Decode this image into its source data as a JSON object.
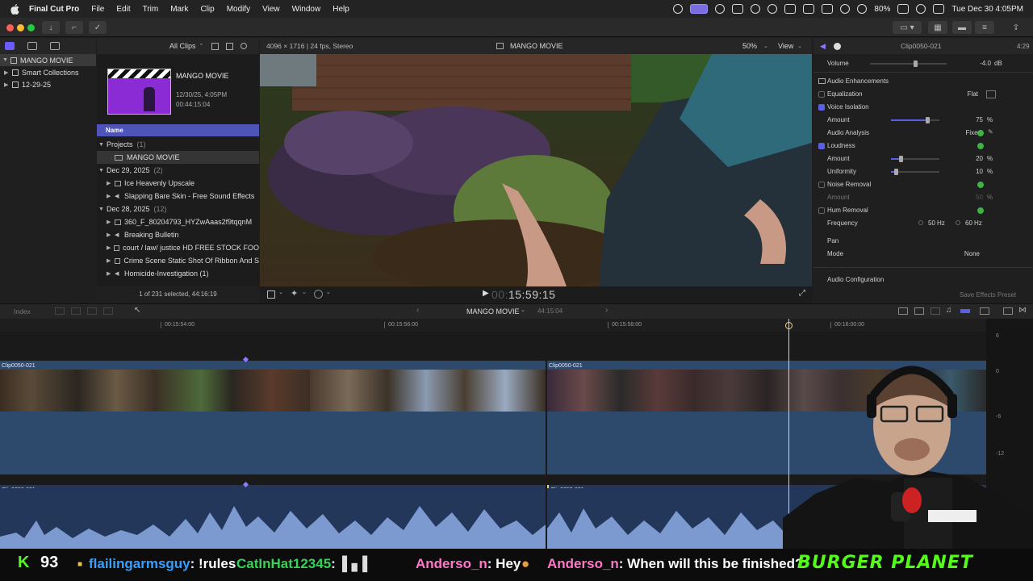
{
  "menubar": {
    "app_name": "Final Cut Pro",
    "items": [
      "File",
      "Edit",
      "Trim",
      "Mark",
      "Clip",
      "Modify",
      "View",
      "Window",
      "Help"
    ],
    "battery": "80%",
    "datetime": "Tue Dec 30  4:05PM"
  },
  "library": {
    "root": "MANGO MOVIE",
    "items": [
      {
        "label": "Smart Collections"
      },
      {
        "label": "12-29-25"
      }
    ]
  },
  "browser": {
    "filter": "All Clips",
    "project_title": "MANGO MOVIE",
    "project_date": "12/30/25, 4:05PM",
    "project_duration": "00:44:15:04",
    "column_name": "Name",
    "groups": [
      {
        "label": "Projects",
        "count": "(1)",
        "rows": [
          "MANGO MOVIE"
        ]
      },
      {
        "label": "Dec 29, 2025",
        "count": "(2)",
        "rows": [
          "Ice Heavenly Upscale",
          "Slapping Bare Skin - Free Sound Effects"
        ]
      },
      {
        "label": "Dec 28, 2025",
        "count": "(12)",
        "rows": [
          "360_F_80204793_HYZwAaas2f9tqqnM",
          "Breaking Bulletin",
          "court / law/ justice HD FREE STOCK FOO",
          "Crime Scene Static Shot Of Ribbon And S",
          "Homicide-Investigation (1)"
        ]
      }
    ],
    "footer": "1 of 231 selected, 44:16:19"
  },
  "viewer": {
    "format": "4096 × 1716 | 24 fps, Stereo",
    "title": "MANGO MOVIE",
    "zoom": "50%",
    "view_label": "View",
    "timecode_dim": "00:",
    "timecode": "15:59:15"
  },
  "inspector": {
    "clip_name": "Clip0050-021",
    "duration": "4:29",
    "volume_label": "Volume",
    "volume_value": "-4.0",
    "volume_unit": "dB",
    "enhancements_label": "Audio Enhancements",
    "equalization_label": "Equalization",
    "equalization_value": "Flat",
    "voice_isolation_label": "Voice Isolation",
    "vi_amount_label": "Amount",
    "vi_amount_value": "75",
    "vi_amount_level": 0.75,
    "audio_analysis_label": "Audio Analysis",
    "audio_analysis_value": "Fixed",
    "loudness_label": "Loudness",
    "loud_amount_label": "Amount",
    "loud_amount_value": "20",
    "loud_amount_level": 0.2,
    "uniformity_label": "Uniformity",
    "uniformity_value": "10",
    "uniformity_level": 0.1,
    "noise_label": "Noise Removal",
    "noise_amount_label": "Amount",
    "noise_amount_value": "50",
    "hum_label": "Hum Removal",
    "frequency_label": "Frequency",
    "freq_50": "50",
    "freq_60": "60",
    "freq_unit": "Hz",
    "percent": "%",
    "pan_label": "Pan",
    "mode_label": "Mode",
    "mode_value": "None",
    "audio_config_label": "Audio Configuration",
    "save_preset_label": "Save Effects Preset"
  },
  "timeline": {
    "index_label": "Index",
    "project_title": "MANGO MOVIE",
    "project_duration": "44:15:04",
    "ruler": [
      "00:15:54:00",
      "00:15:56:00",
      "00:15:58:00",
      "00:16:00:00"
    ],
    "clip_a": "Clip0050-021",
    "clip_b": "Clip0050-021",
    "audio_a": "Clip0050-021",
    "audio_b": "Clip0050-021",
    "meter_labels": [
      "6",
      "0",
      "-6",
      "-12"
    ]
  },
  "stream": {
    "kick_count": "93",
    "messages": [
      {
        "user": "flailingarmsguy",
        "text": ": !rules",
        "color": "#35a0ff"
      },
      {
        "user": "CatInHat12345",
        "text": ":",
        "color": "#36d255"
      },
      {
        "user": "Anderso_n",
        "text": ": Hey",
        "color": "#ff78c8"
      },
      {
        "user": "Anderso_n",
        "text": ": When will this be finished?",
        "color": "#ff78c8"
      }
    ],
    "brand": "BURGER PLANET"
  },
  "colors": {
    "accent": "#5b5fe6",
    "playhead": "#f0d56a",
    "clip": "#2d4a6d",
    "kick_green": "#53fc18"
  }
}
